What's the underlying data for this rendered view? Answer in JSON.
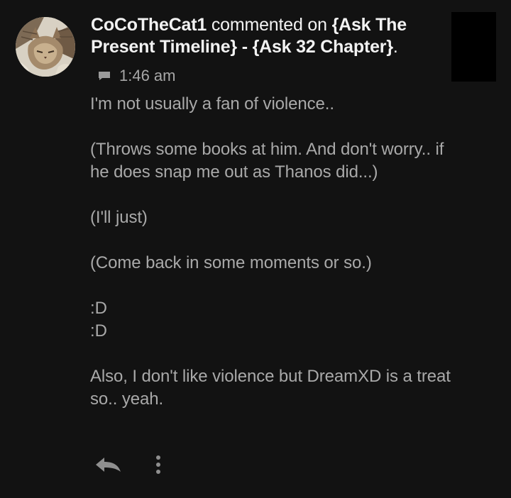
{
  "comment": {
    "author": "CoCoTheCat1",
    "action_text": " commented on ",
    "target_title": "{Ask The Present Timeline} - {Ask 32 Chapter}",
    "period": ".",
    "timestamp": "1:46 am",
    "paragraphs": [
      "I'm not usually a fan of violence..",
      "(Throws some books at him. And don't worry.. if he does snap me out as Thanos did...)",
      "(I'll just)",
      "(Come back in some moments or so.)",
      ":D\n:D",
      "Also, I don't like violence but DreamXD is a treat so.. yeah."
    ]
  },
  "icons": {
    "comment": "comment-icon",
    "reply": "reply-icon",
    "more": "more-vertical-icon"
  },
  "colors": {
    "background": "#121212",
    "header_text": "#f2f2f2",
    "body_text": "#a9a9a9",
    "meta_text": "#a7a7a7",
    "icon": "#8f8f8f"
  }
}
